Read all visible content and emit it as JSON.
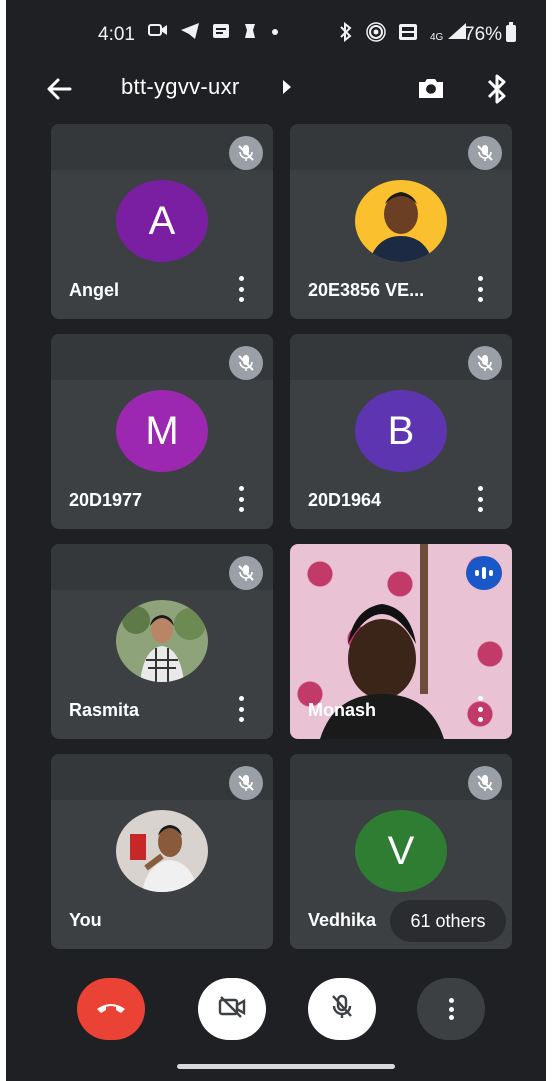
{
  "status_bar": {
    "time": "4:01",
    "network": "4G",
    "battery": "76%",
    "icons": [
      "video-icon",
      "telegram-icon",
      "message-icon",
      "app-icon",
      "dot-icon",
      "bluetooth-icon",
      "hotspot-icon",
      "volte-icon",
      "signal-icon",
      "battery-icon"
    ]
  },
  "top_bar": {
    "meeting_code": "btt-ygvv-uxr",
    "icons": [
      "back-arrow-icon",
      "caret-right-icon",
      "switch-camera-icon",
      "bluetooth-icon"
    ]
  },
  "participants": [
    {
      "name": "Angel",
      "initial": "A",
      "avatar_color": "#7b1fa2",
      "muted": true
    },
    {
      "name": "20E3856 VE...",
      "initial": "",
      "avatar_color": "#fbc02d",
      "muted": true
    },
    {
      "name": "20D1977",
      "initial": "M",
      "avatar_color": "#9c27b0",
      "muted": true
    },
    {
      "name": "20D1964",
      "initial": "B",
      "avatar_color": "#5e35b1",
      "muted": true
    },
    {
      "name": "Rasmita",
      "initial": "",
      "avatar_color": "#8d9c7a",
      "muted": true
    },
    {
      "name": "Monash",
      "initial": "",
      "avatar_color": "#e9c2d4",
      "muted": false,
      "speaking": true
    },
    {
      "name": "You",
      "initial": "",
      "avatar_color": "#d9d3cf",
      "muted": true
    },
    {
      "name": "Vedhika",
      "initial": "V",
      "avatar_color": "#2e7d32",
      "muted": true
    }
  ],
  "others_label": "61 others",
  "controls": {
    "icons": [
      "end-call-icon",
      "camera-off-icon",
      "mic-off-icon",
      "more-vert-icon"
    ],
    "end_call_color": "#ea4335"
  }
}
